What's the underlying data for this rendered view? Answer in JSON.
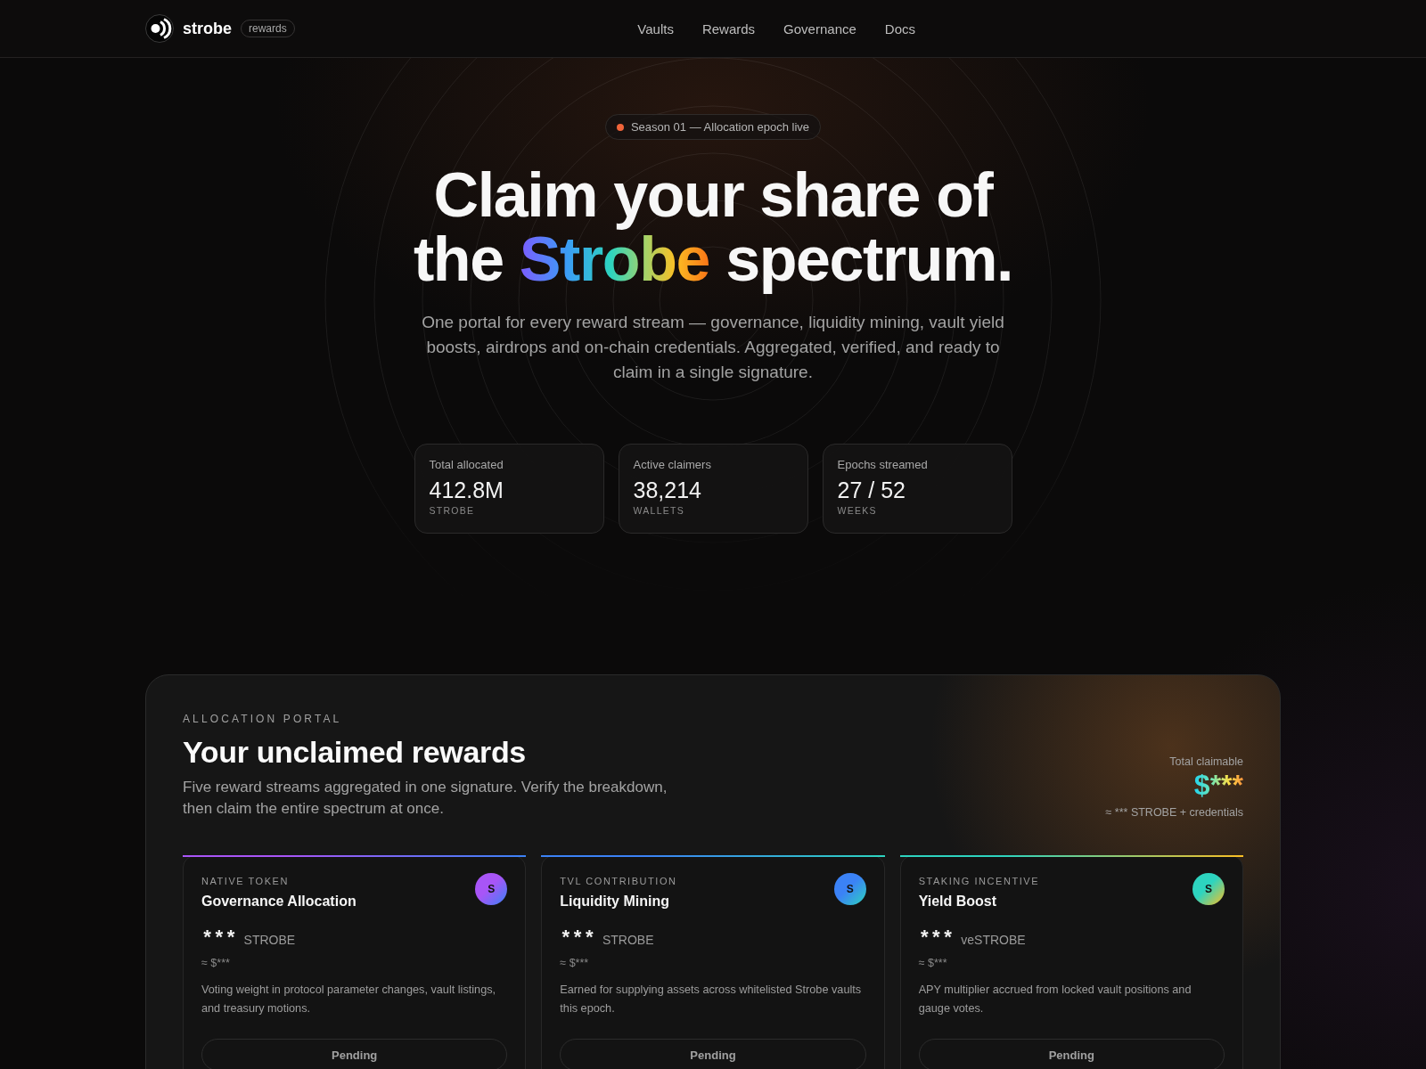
{
  "header": {
    "brand": "strobe",
    "brand_tag": "rewards",
    "nav": [
      "Vaults",
      "Rewards",
      "Governance",
      "Docs"
    ]
  },
  "hero": {
    "badge": "Season 01 — Allocation epoch live",
    "title": {
      "line_1": "Claim your share of",
      "line_2_start": "the",
      "highlight": "Strobe",
      "line_2_end": "spectrum."
    },
    "subtitle": "One portal for every reward stream — governance, liquidity mining, vault yield boosts, airdrops and on-chain credentials. Aggregated, verified, and ready to claim in a single signature.",
    "stats": [
      {
        "label": "Total allocated",
        "value": "412.8M",
        "unit": "STROBE"
      },
      {
        "label": "Active claimers",
        "value": "38,214",
        "unit": "WALLETS"
      },
      {
        "label": "Epochs streamed",
        "value": "27 / 52",
        "unit": "WEEKS"
      }
    ]
  },
  "portal": {
    "eyebrow": "ALLOCATION PORTAL",
    "title": "Your unclaimed rewards",
    "description": "Five reward streams aggregated in one signature. Verify the breakdown, then claim the entire spectrum at once.",
    "total": {
      "label": "Total claimable",
      "amount": "$***",
      "note": "≈ *** STROBE + credentials"
    },
    "streams": [
      {
        "category": "NATIVE TOKEN",
        "title": "Governance Allocation",
        "symbol": "S",
        "amount": "***",
        "token": "STROBE",
        "usd": "≈ $***",
        "description": "Voting weight in protocol parameter changes, vault listings, and treasury motions.",
        "action": "Pending",
        "color": "#a855f7"
      },
      {
        "category": "TVL CONTRIBUTION",
        "title": "Liquidity Mining",
        "symbol": "S",
        "amount": "***",
        "token": "STROBE",
        "usd": "≈ $***",
        "description": "Earned for supplying assets across whitelisted Strobe vaults this epoch.",
        "action": "Pending",
        "color": "#3b82f6"
      },
      {
        "category": "STAKING INCENTIVE",
        "title": "Yield Boost",
        "symbol": "S",
        "amount": "***",
        "token": "veSTROBE",
        "usd": "≈ $***",
        "description": "APY multiplier accrued from locked vault positions and gauge votes.",
        "action": "Pending",
        "color": "#2dd4bf"
      }
    ]
  }
}
